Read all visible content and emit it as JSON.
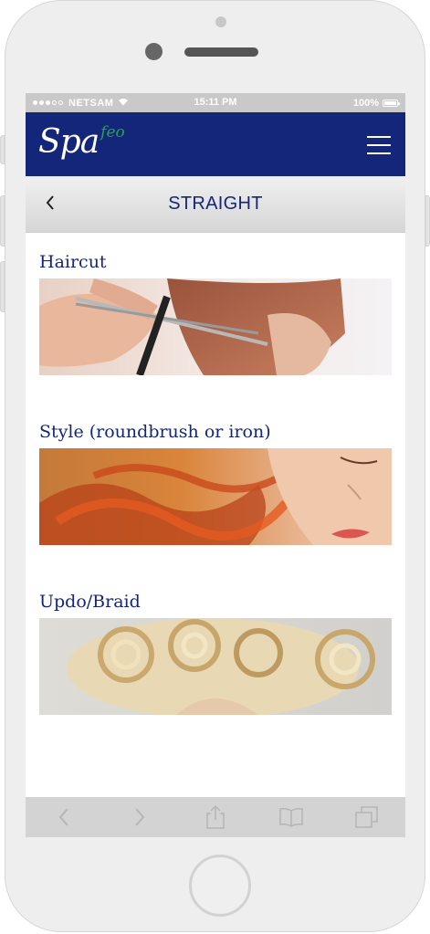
{
  "status_bar": {
    "carrier": "NETSAM",
    "time": "15:11 PM",
    "battery": "100%"
  },
  "app": {
    "logo_text": "Spa",
    "logo_sup": "feo"
  },
  "header": {
    "title": "STRAIGHT"
  },
  "services": [
    {
      "label": "Haircut"
    },
    {
      "label": "Style (roundbrush or iron)"
    },
    {
      "label": "Updo/Braid"
    }
  ],
  "colors": {
    "brand_navy": "#14267a",
    "logo_green": "#25a34a",
    "statusbar_gray": "#c9c9c9"
  },
  "icons": [
    "back-arrow-icon",
    "menu-icon",
    "browser-back-icon",
    "browser-forward-icon",
    "share-icon",
    "bookmarks-icon",
    "tabs-icon"
  ]
}
